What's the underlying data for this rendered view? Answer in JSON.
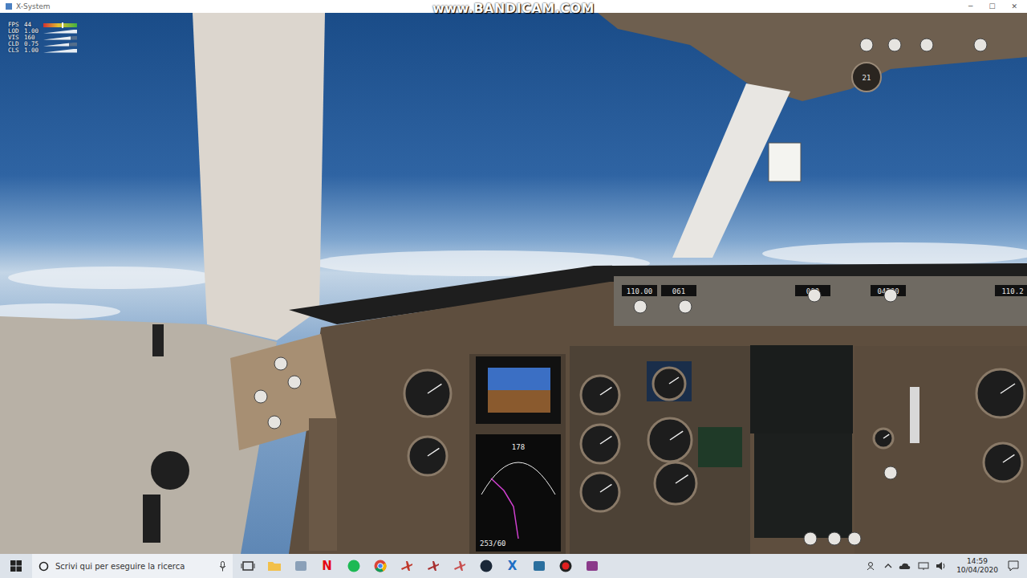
{
  "window": {
    "title": "X-System",
    "controls": [
      "─",
      "☐",
      "✕"
    ]
  },
  "watermark": "www.BANDICAM.COM",
  "stats": [
    {
      "label": "FPS",
      "value": "44",
      "kind": "traffic",
      "level": 0.55
    },
    {
      "label": "LOD",
      "value": "1.00",
      "kind": "ramp",
      "level": 1
    },
    {
      "label": "VIS",
      "value": "160",
      "kind": "ramp",
      "level": 0.8
    },
    {
      "label": "CLD",
      "value": "0.75",
      "kind": "ramp",
      "level": 0.75
    },
    {
      "label": "CLS",
      "value": "1.00",
      "kind": "ramp",
      "level": 1
    }
  ],
  "cockpit": {
    "mcp_readouts": [
      "110.00",
      "061",
      "000",
      "04200",
      "110.2"
    ],
    "nd_heading": "178",
    "nd_range": "253/60",
    "clock": "21"
  },
  "taskbar": {
    "search_placeholder": "Scrivi qui per eseguire la ricerca",
    "apps": [
      {
        "kind": "taskview",
        "color": "#333333"
      },
      {
        "kind": "folder",
        "color": "#f2c04a"
      },
      {
        "kind": "box",
        "color": "#8aa0b8"
      },
      {
        "kind": "glyph",
        "glyph": "N",
        "color": "#e50914"
      },
      {
        "kind": "circle",
        "color": "#1db954"
      },
      {
        "kind": "chrome",
        "color": "#4285f4"
      },
      {
        "kind": "plane",
        "color": "#c0392b"
      },
      {
        "kind": "plane",
        "color": "#a83030"
      },
      {
        "kind": "plane",
        "color": "#c85050"
      },
      {
        "kind": "circle",
        "color": "#1b2838"
      },
      {
        "kind": "glyph",
        "glyph": "X",
        "color": "#1e6fc4"
      },
      {
        "kind": "box",
        "color": "#2a6f9e"
      },
      {
        "kind": "record",
        "color": "#e02020"
      },
      {
        "kind": "box",
        "color": "#8a3a8a"
      }
    ],
    "time": "14:59",
    "date": "10/04/2020"
  }
}
